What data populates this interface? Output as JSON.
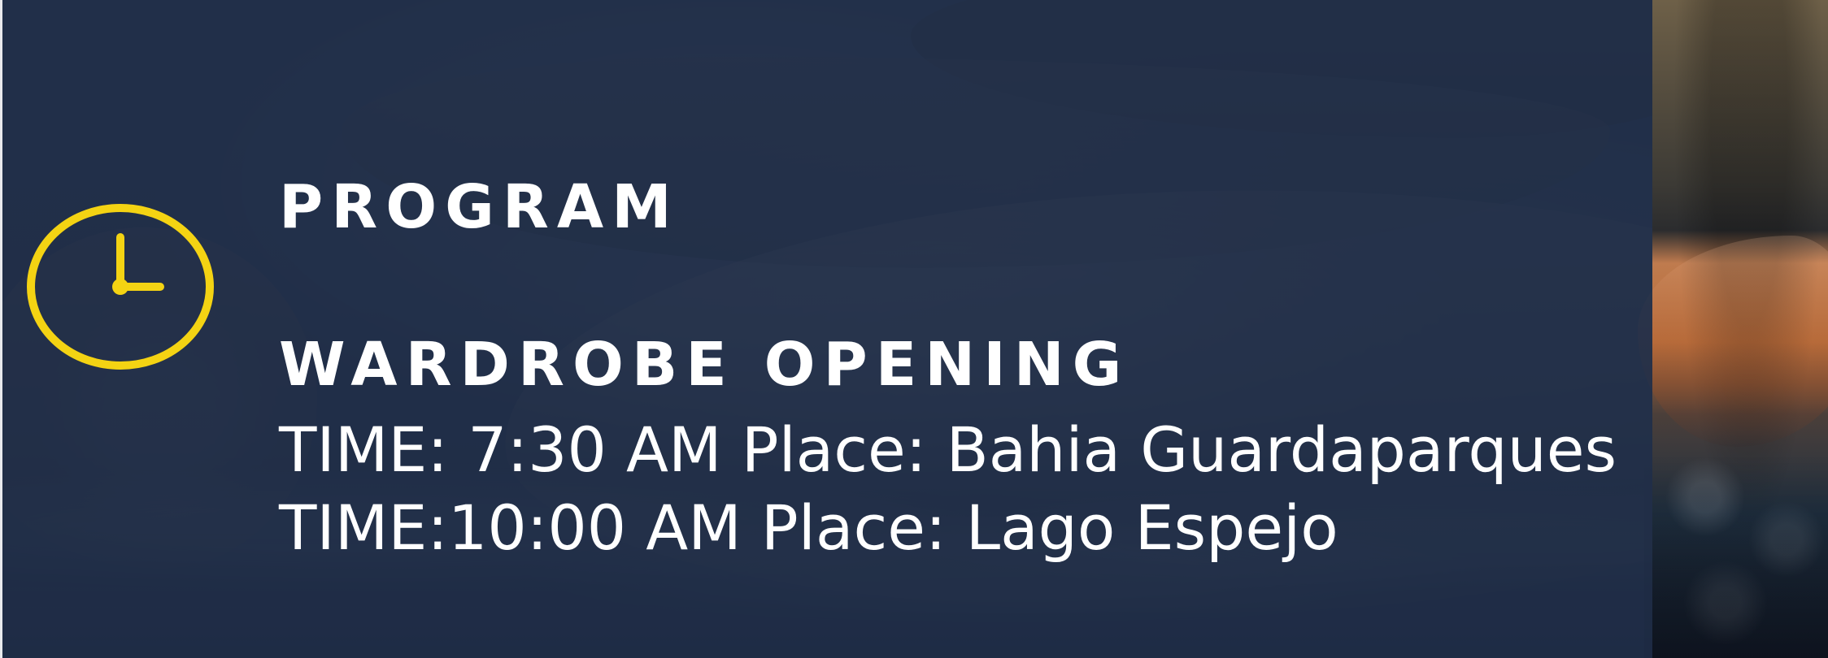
{
  "colors": {
    "overlay": "#1f2d47",
    "accent_icon": "#f4d313",
    "text": "#ffffff"
  },
  "icons": {
    "time": "clock-icon"
  },
  "program": {
    "section_title": "PROGRAM",
    "event_title": "WARDROBE OPENING",
    "schedule": [
      {
        "text": "TIME: 7:30 AM Place: Bahia Guardaparques"
      },
      {
        "text": "TIME:10:00 AM Place: Lago Espejo"
      }
    ]
  }
}
